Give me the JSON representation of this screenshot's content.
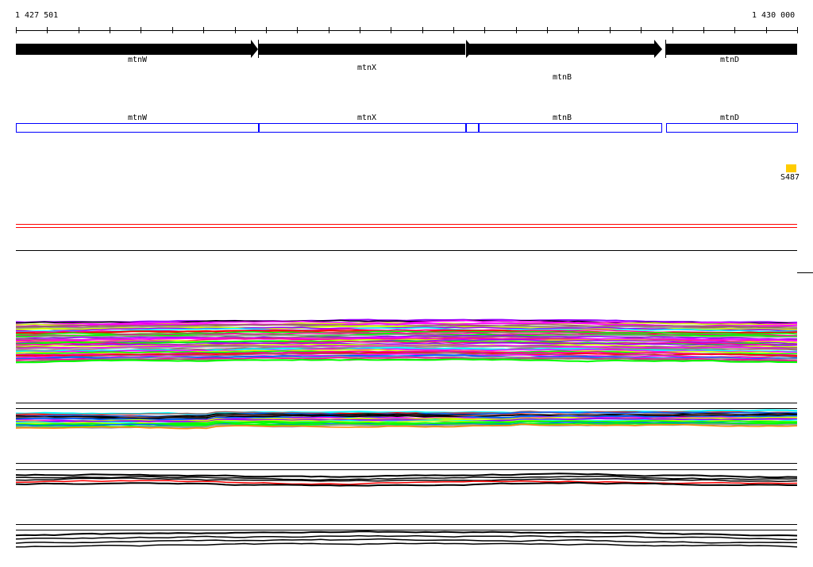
{
  "ruler": {
    "start_label": "1 427 501",
    "end_label": "1 430 000",
    "tick_count": 25
  },
  "genes": [
    {
      "name": "mtnW",
      "arrow": true
    },
    {
      "name": "mtnX",
      "arrow": true
    },
    {
      "name": "mtnB",
      "arrow": true
    },
    {
      "name": "mtnD",
      "arrow": false
    }
  ],
  "annotation_boxes": [
    {
      "label": "mtnW"
    },
    {
      "label": "mtnX"
    },
    {
      "label": ""
    },
    {
      "label": "mtnB"
    },
    {
      "label": "mtnD"
    }
  ],
  "marker": {
    "label": "S487",
    "color": "#ffcc00"
  },
  "colors": {
    "track_palette": [
      "#ff00ff",
      "#00ffff",
      "#ff0000",
      "#00ff00",
      "#0066ff",
      "#ff8800",
      "#999999",
      "#996666",
      "#ccff00",
      "#9900ff",
      "#ff0099",
      "#000000"
    ],
    "gene": "#000000",
    "box": "#0000ff",
    "red": "#ff0000"
  }
}
